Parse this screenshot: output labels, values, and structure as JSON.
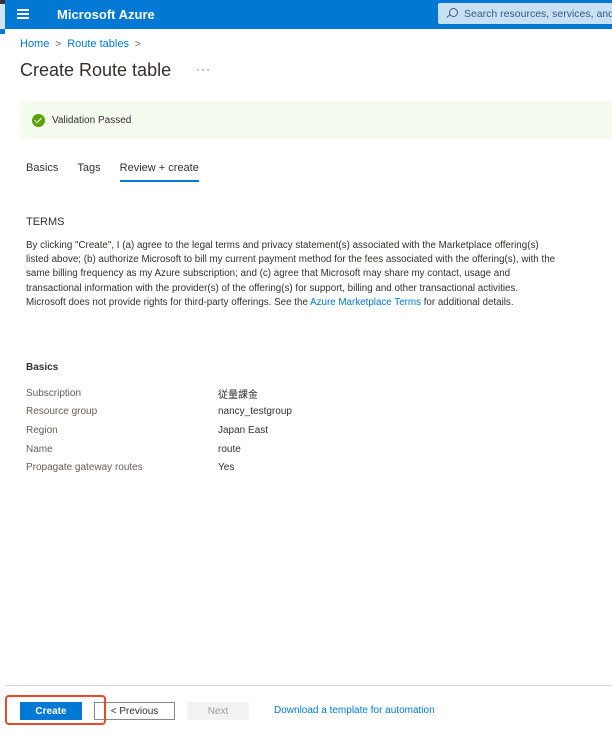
{
  "header": {
    "brand": "Microsoft Azure",
    "search_placeholder": "Search resources, services, and docs (G+/)"
  },
  "breadcrumb": {
    "items": [
      "Home",
      "Route tables"
    ],
    "separator": ">"
  },
  "page": {
    "title": "Create Route table",
    "more": "···"
  },
  "validation": {
    "status": "success",
    "text": "Validation Passed",
    "color": "#57a300"
  },
  "tabs": [
    {
      "label": "Basics",
      "active": false
    },
    {
      "label": "Tags",
      "active": false
    },
    {
      "label": "Review + create",
      "active": true
    }
  ],
  "terms": {
    "heading": "TERMS",
    "text_before_link": "By clicking \"Create\", I (a) agree to the legal terms and privacy statement(s) associated with the Marketplace offering(s) listed above; (b) authorize Microsoft to bill my current payment method for the fees associated with the offering(s), with the same billing frequency as my Azure subscription; and (c) agree that Microsoft may share my contact, usage and transactional information with the provider(s) of the offering(s) for support, billing and other transactional activities. Microsoft does not provide rights for third-party offerings. See the ",
    "link_text": "Azure Marketplace Terms",
    "text_after_link": " for additional details."
  },
  "basics": {
    "heading": "Basics",
    "rows": [
      {
        "label": "Subscription",
        "value": "従量課金"
      },
      {
        "label": "Resource group",
        "value": "nancy_testgroup"
      },
      {
        "label": "Region",
        "value": "Japan East"
      },
      {
        "label": "Name",
        "value": "route"
      },
      {
        "label": "Propagate gateway routes",
        "value": "Yes"
      }
    ]
  },
  "footer": {
    "create_label": "Create",
    "previous_label": "< Previous",
    "next_label": "Next",
    "download_link": "Download a template for automation"
  },
  "colors": {
    "accent": "#0078d4",
    "highlight": "#e8492b"
  }
}
